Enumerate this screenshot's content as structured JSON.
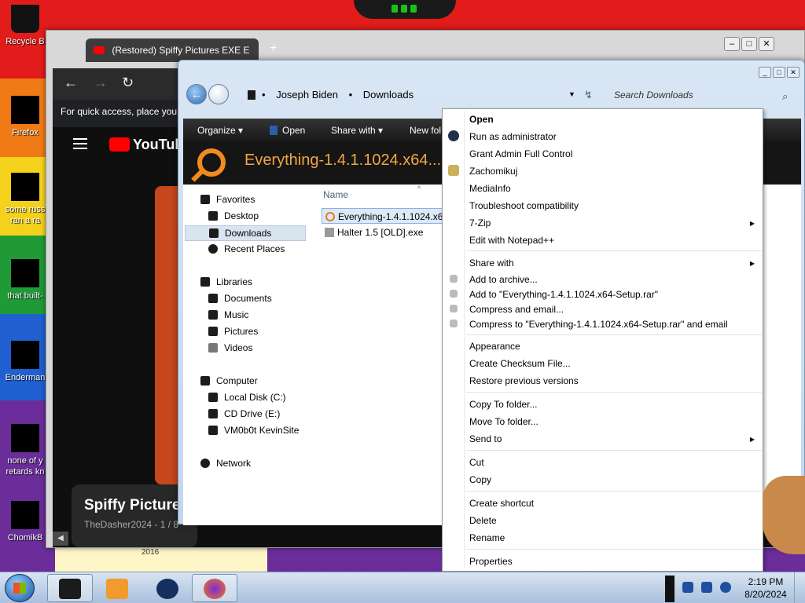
{
  "desktop": {
    "icons": [
      {
        "label": "Recycle B"
      },
      {
        "label": "Firefox"
      },
      {
        "label": "some russ\nran a ra"
      },
      {
        "label": "that built-"
      },
      {
        "label": "Enderman"
      },
      {
        "label": "none of y\nretards kn"
      },
      {
        "label": "ChomikB"
      }
    ],
    "bottom_label": "2016"
  },
  "browser": {
    "tab_title": "(Restored) Spiffy Pictures EXE E",
    "quick_access_text": "For quick access, place your",
    "youtube_logo": "YouTube",
    "card_title": "Spiffy Picture",
    "card_subtitle": "TheDasher2024 - 1 / 8"
  },
  "explorer": {
    "breadcrumb": [
      "Joseph Biden",
      "Downloads"
    ],
    "search_placeholder": "Search Downloads",
    "toolbar": {
      "organize": "Organize",
      "open": "Open",
      "share_with": "Share with",
      "new_folder": "New fol"
    },
    "banner_title": "Everything-1.4.1.1024.x64....",
    "column_name": "Name",
    "nav": {
      "favorites": "Favorites",
      "desktop": "Desktop",
      "downloads": "Downloads",
      "recent_places": "Recent Places",
      "libraries": "Libraries",
      "documents": "Documents",
      "music": "Music",
      "pictures": "Pictures",
      "videos": "Videos",
      "computer": "Computer",
      "local_disk": "Local Disk (C:)",
      "cd_drive": "CD Drive (E:)",
      "vm": "VM0b0t KevinSite",
      "network": "Network"
    },
    "files": [
      "Everything-1.4.1.1024.x64",
      "Halter 1.5 [OLD].exe"
    ]
  },
  "context_menu": {
    "open": "Open",
    "run_admin": "Run as administrator",
    "grant_admin": "Grant Admin Full Control",
    "zachomikuj": "Zachomikuj",
    "mediainfo": "MediaInfo",
    "troubleshoot": "Troubleshoot compatibility",
    "sevenzip": "7-Zip",
    "notepad": "Edit with Notepad++",
    "share_with": "Share with",
    "add_archive": "Add to archive...",
    "add_rar": "Add to \"Everything-1.4.1.1024.x64-Setup.rar\"",
    "compress_email": "Compress and email...",
    "compress_rar_email": "Compress to \"Everything-1.4.1.1024.x64-Setup.rar\" and email",
    "appearance": "Appearance",
    "checksum": "Create Checksum File...",
    "restore": "Restore previous versions",
    "copy_to": "Copy To folder...",
    "move_to": "Move To folder...",
    "send_to": "Send to",
    "cut": "Cut",
    "copy": "Copy",
    "create_shortcut": "Create shortcut",
    "delete": "Delete",
    "rename": "Rename",
    "properties": "Properties"
  },
  "taskbar": {
    "time": "2:19 PM",
    "date": "8/20/2024"
  }
}
